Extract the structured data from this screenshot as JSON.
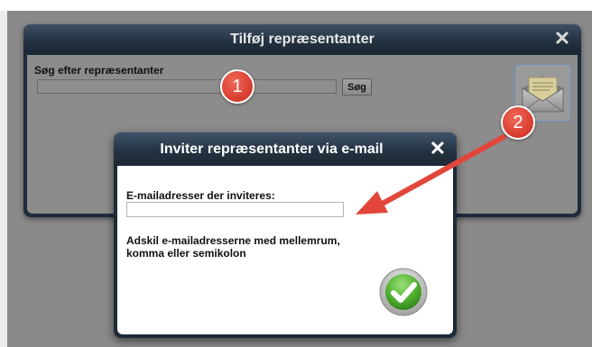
{
  "outer_dialog": {
    "title": "Tilføj repræsentanter",
    "close_glyph": "✕",
    "search_label": "Søg efter repræsentanter",
    "search_value": "",
    "search_button": "Søg",
    "email_icon": "envelope-icon"
  },
  "inner_dialog": {
    "title": "Inviter repræsentanter via e-mail",
    "close_glyph": "✕",
    "email_label": "E-mailadresser der inviteres:",
    "email_value": "",
    "help_line1": "Adskil e-mailadresserne med mellemrum,",
    "help_line2": "komma eller semikolon",
    "confirm_icon": "checkmark-icon"
  },
  "annotations": {
    "badge_1": "1",
    "badge_2": "2"
  },
  "colors": {
    "title_bar": "#22303f",
    "badge": "#d63a2c",
    "arrow": "#e2463b",
    "confirm": "#5cbf3a"
  }
}
